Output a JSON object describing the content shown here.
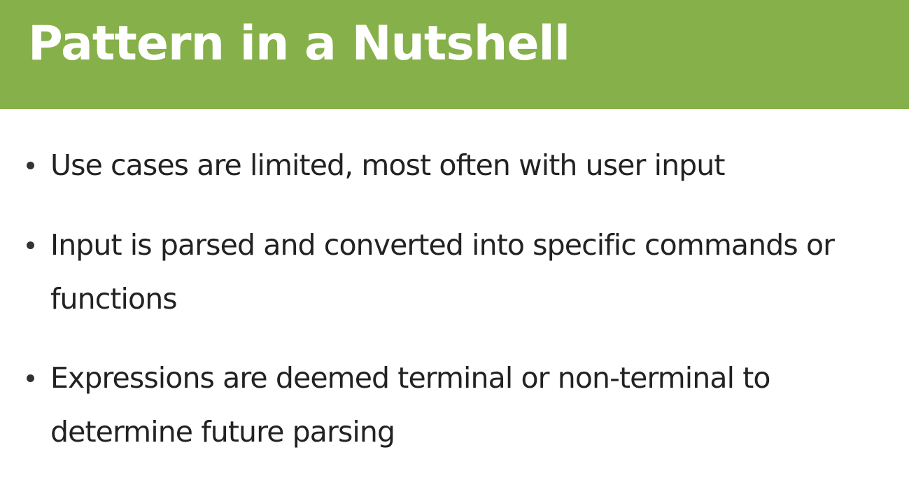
{
  "slide": {
    "title": "Pattern in a Nutshell",
    "bullets": [
      {
        "text": "Use cases are limited, most often with user input"
      },
      {
        "text": "Input is parsed and converted into specific commands or functions"
      },
      {
        "text": "Expressions are deemed terminal or non-terminal to determine future parsing"
      }
    ]
  },
  "colors": {
    "title_bar": "#86b049",
    "title_text": "#ffffff",
    "body_text": "#222222",
    "background": "#ffffff"
  }
}
